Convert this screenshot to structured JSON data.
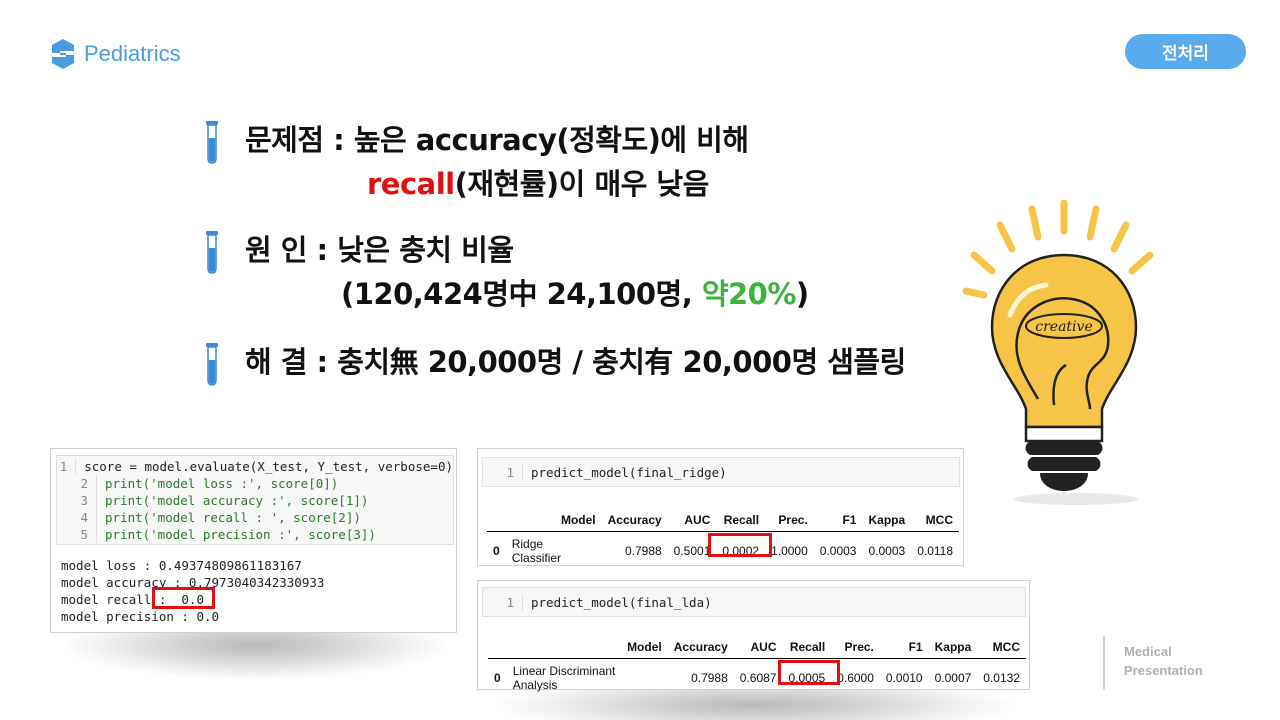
{
  "header": {
    "brand": "Pediatrics",
    "badge": "전처리"
  },
  "bullets": {
    "b1_line1": "문제점 : 높은 accuracy(정확도)에 비해",
    "b1_line2_red": "recall",
    "b1_line2_rest": "(재현률)이 매우 낮음",
    "b2_line1": "원 인 : 낮은 충치 비율",
    "b2_line2_pre": "(120,424명中 24,100명, ",
    "b2_line2_green": "약20%",
    "b2_line2_post": ")",
    "b3_line1": "해 결 : 충치無 20,000명 / 충치有 20,000명 샘플링"
  },
  "code_panel": {
    "lines": [
      {
        "n": "1",
        "code": "score = model.evaluate(X_test, Y_test, verbose=0)"
      },
      {
        "n": "2",
        "code": "print('model loss :', score[0])"
      },
      {
        "n": "3",
        "code": "print('model accuracy :', score[1])"
      },
      {
        "n": "4",
        "code": "print('model recall : ', score[2])"
      },
      {
        "n": "5",
        "code": "print('model precision :', score[3])"
      }
    ],
    "output": [
      "model loss : 0.49374809861183167",
      "model accuracy : 0.7973040342330933",
      "model recall :  0.0",
      "model precision : 0.0"
    ]
  },
  "ridge_panel": {
    "line_no": "1",
    "code": "predict_model(final_ridge)",
    "headers": [
      "",
      "Model",
      "Accuracy",
      "AUC",
      "Recall",
      "Prec.",
      "F1",
      "Kappa",
      "MCC"
    ],
    "row": [
      "0",
      "Ridge Classifier",
      "0.7988",
      "0.5001",
      "0.0002",
      "1.0000",
      "0.0003",
      "0.0003",
      "0.0118"
    ]
  },
  "lda_panel": {
    "line_no": "1",
    "code": "predict_model(final_lda)",
    "headers": [
      "",
      "Model",
      "Accuracy",
      "AUC",
      "Recall",
      "Prec.",
      "F1",
      "Kappa",
      "MCC"
    ],
    "row": [
      "0",
      "Linear Discriminant Analysis",
      "0.7988",
      "0.6087",
      "0.0005",
      "0.6000",
      "0.0010",
      "0.0007",
      "0.0132"
    ]
  },
  "illustration": {
    "bulb_label": "creative",
    "bulb_color": "#f6c548"
  },
  "footer": {
    "line1": "Medical",
    "line2": "Presentation"
  }
}
